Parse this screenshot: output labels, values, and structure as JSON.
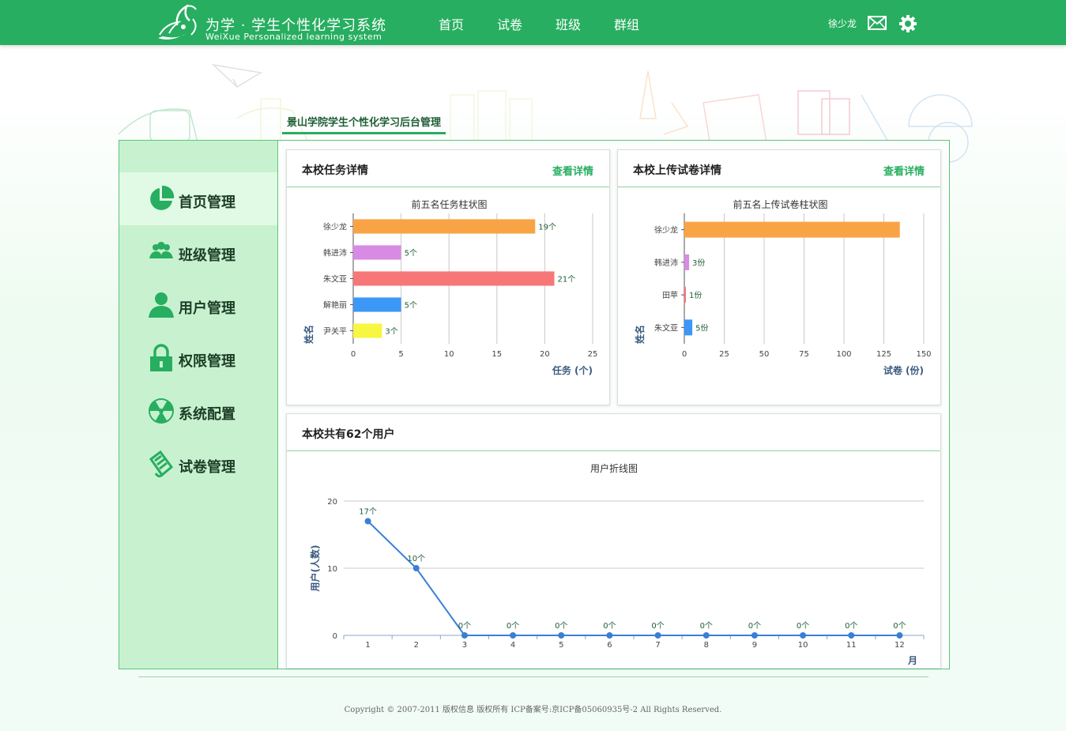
{
  "app": {
    "title": "为学 · 学生个性化学习系统",
    "subtitle": "WeiXue Personalized learning system"
  },
  "nav": [
    {
      "label": "首页"
    },
    {
      "label": "试卷"
    },
    {
      "label": "班级"
    },
    {
      "label": "群组"
    }
  ],
  "user": {
    "name": "徐少龙"
  },
  "breadcrumb": "景山学院学生个性化学习后台管理",
  "sidebar": {
    "items": [
      {
        "label": "首页管理",
        "icon": "pie-chart-icon",
        "active": true
      },
      {
        "label": "班级管理",
        "icon": "group-icon"
      },
      {
        "label": "用户管理",
        "icon": "user-icon"
      },
      {
        "label": "权限管理",
        "icon": "lock-icon"
      },
      {
        "label": "系统配置",
        "icon": "radiation-icon"
      },
      {
        "label": "试卷管理",
        "icon": "paper-icon"
      }
    ]
  },
  "cards": {
    "tasks": {
      "title": "本校任务详情",
      "link": "查看详情"
    },
    "papers": {
      "title": "本校上传试卷详情",
      "link": "查看详情"
    },
    "users": {
      "title": "本校共有62个用户"
    }
  },
  "colors": {
    "brand": "#27ae60",
    "sidebar": "#c8f2cf",
    "line": "#3a7fd5"
  },
  "chart_data": [
    {
      "type": "bar",
      "orientation": "horizontal",
      "title": "前五名任务柱状图",
      "xlabel": "任务 (个)",
      "ylabel": "姓名",
      "categories": [
        "徐少龙",
        "韩进沛",
        "朱文亚",
        "解艳丽",
        "尹关平"
      ],
      "values": [
        19,
        5,
        21,
        5,
        3
      ],
      "data_labels": [
        "19个",
        "5个",
        "21个",
        "5个",
        "3个"
      ],
      "bar_colors": [
        "#f8a445",
        "#d88be4",
        "#f77779",
        "#3d97f6",
        "#f7f641"
      ],
      "xticks": [
        0,
        5,
        10,
        15,
        20,
        25
      ],
      "xlim": [
        0,
        25
      ]
    },
    {
      "type": "bar",
      "orientation": "horizontal",
      "title": "前五名上传试卷柱状图",
      "xlabel": "试卷 (份)",
      "ylabel": "姓名",
      "categories": [
        "徐少龙",
        "韩进沛",
        "田苹",
        "朱文亚"
      ],
      "values": [
        135,
        3,
        1,
        5
      ],
      "data_labels": [
        "",
        "3份",
        "1份",
        "5份"
      ],
      "bar_colors": [
        "#f8a445",
        "#d88be4",
        "#f77779",
        "#3d97f6"
      ],
      "xticks": [
        0,
        25,
        50,
        75,
        100,
        125,
        150
      ],
      "xlim": [
        0,
        150
      ]
    },
    {
      "type": "line",
      "title": "用户折线图",
      "xlabel": "月",
      "ylabel": "用户(人数)",
      "x": [
        1,
        2,
        3,
        4,
        5,
        6,
        7,
        8,
        9,
        10,
        11,
        12
      ],
      "values": [
        17,
        10,
        0,
        0,
        0,
        0,
        0,
        0,
        0,
        0,
        0,
        0
      ],
      "data_labels": [
        "17个",
        "10个",
        "0个",
        "0个",
        "0个",
        "0个",
        "0个",
        "0个",
        "0个",
        "0个",
        "0个",
        "0个"
      ],
      "yticks": [
        0,
        10,
        20
      ],
      "ylim": [
        0,
        20
      ],
      "grid": true
    }
  ],
  "footer": "Copyright © 2007-2011 版权信息 版权所有 ICP备案号:京ICP备05060935号-2 All Rights Reserved."
}
